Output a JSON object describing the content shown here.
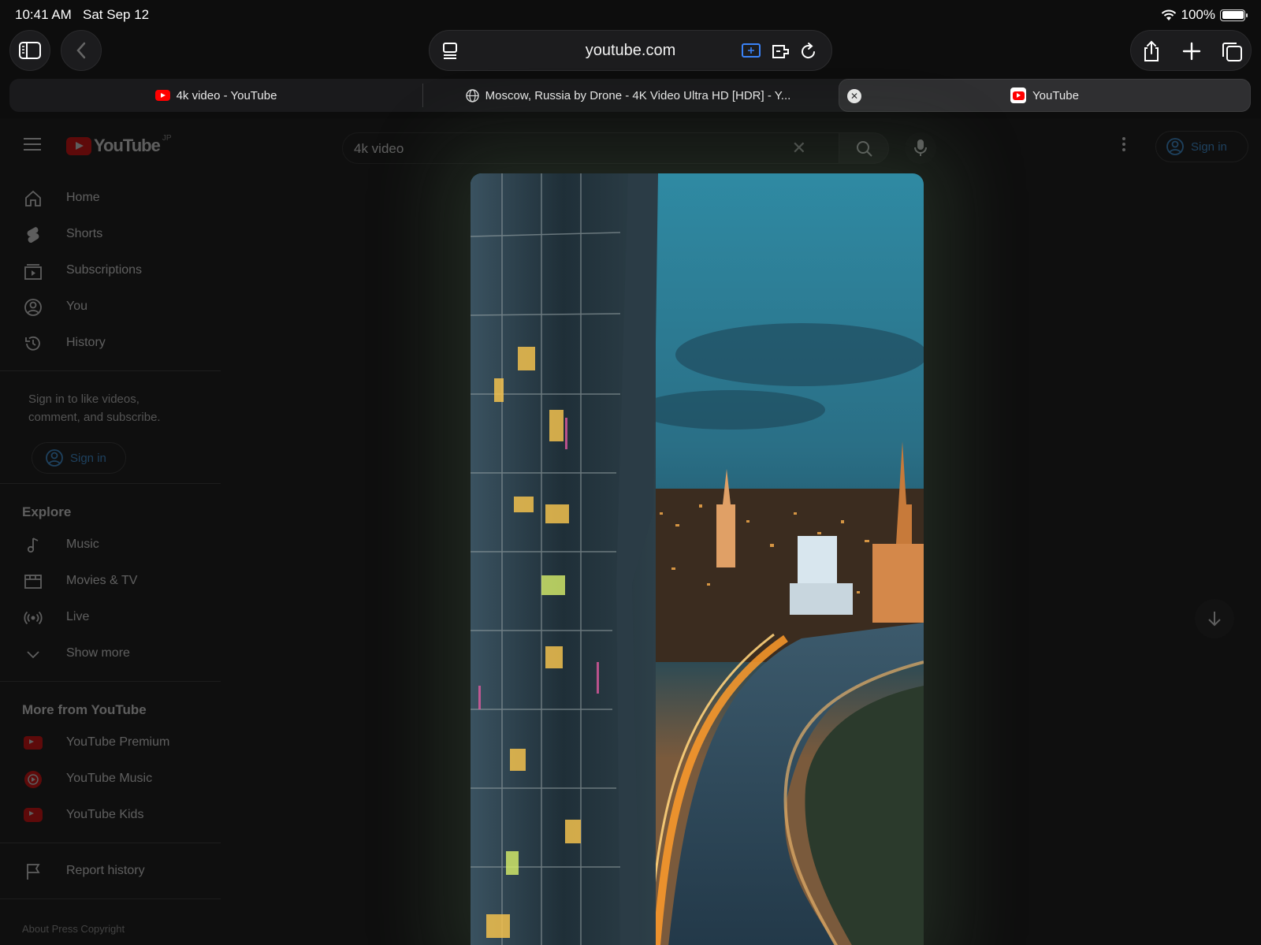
{
  "status": {
    "time": "10:41 AM",
    "date": "Sat Sep 12",
    "battery": "100%",
    "battery_level": 1.0
  },
  "browser": {
    "address": "youtube.com",
    "tabs": [
      {
        "label": "4k video - YouTube"
      },
      {
        "label": "Moscow, Russia by Drone - 4K Video Ultra HD [HDR] - Y..."
      },
      {
        "label": "YouTube"
      }
    ]
  },
  "youtube": {
    "logo_text": "YouTube",
    "country": "JP",
    "search_value": "4k video",
    "signin_label": "Sign in",
    "nav": [
      {
        "label": "Home",
        "icon": "home-icon"
      },
      {
        "label": "Shorts",
        "icon": "shorts-icon"
      },
      {
        "label": "Subscriptions",
        "icon": "subscriptions-icon"
      },
      {
        "label": "You",
        "icon": "you-icon"
      },
      {
        "label": "History",
        "icon": "history-icon"
      }
    ],
    "signin_prompt": "Sign in to like videos, comment, and subscribe.",
    "explore_heading": "Explore",
    "explore": [
      {
        "label": "Music",
        "icon": "music-icon"
      },
      {
        "label": "Movies & TV",
        "icon": "movies-icon"
      },
      {
        "label": "Live",
        "icon": "live-icon"
      },
      {
        "label": "Show more",
        "icon": "chevron-down-icon"
      }
    ],
    "more_heading": "More from YouTube",
    "more": [
      {
        "label": "YouTube Premium"
      },
      {
        "label": "YouTube Music"
      },
      {
        "label": "YouTube Kids"
      }
    ],
    "report_history": "Report history",
    "footer": "About  Press  Copyright"
  },
  "colors": {
    "accent": "#3ea6ff",
    "brand": "#ff0000"
  }
}
